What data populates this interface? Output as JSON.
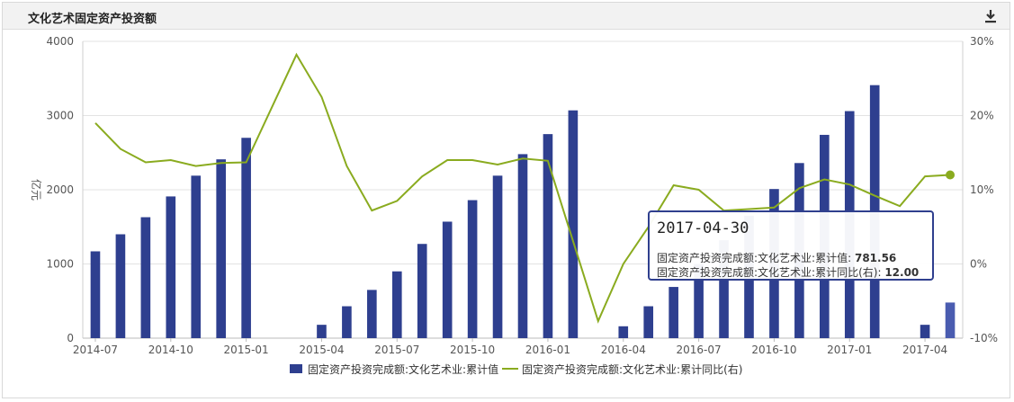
{
  "panel": {
    "title": "文化艺术固定资产投资额",
    "download_icon": "download-icon"
  },
  "tooltip": {
    "date": "2017-04-30",
    "row1_label": "固定资产投资完成额:文化艺术业:累计值:",
    "row1_value": "781.56",
    "row2_label": "固定资产投资完成额:文化艺术业:累计同比(右):",
    "row2_value": "12.00"
  },
  "chart_data": {
    "type": "bar",
    "ylabel": "亿元",
    "y_left_ticks": [
      "4000",
      "3000",
      "2000",
      "1000",
      "0"
    ],
    "y_right_ticks": [
      "30%",
      "20%",
      "10%",
      "0%",
      "-10%"
    ],
    "ylim": [
      0,
      4000
    ],
    "y2lim": [
      -10,
      30
    ],
    "x_tick_labels": [
      "2014-07",
      "2014-10",
      "2015-01",
      "2015-04",
      "2015-07",
      "2015-10",
      "2016-01",
      "2016-04",
      "2016-07",
      "2016-10",
      "2017-01",
      "2017-04"
    ],
    "x_ticks_months": [
      "2014-07",
      "2014-10",
      "2015-01",
      "2015-04",
      "2015-07",
      "2015-10",
      "2016-01",
      "2016-04",
      "2016-07",
      "2016-10",
      "2017-01",
      "2017-04"
    ],
    "months": [
      "2014-07",
      "2014-08",
      "2014-09",
      "2014-10",
      "2014-11",
      "2014-12",
      "2015-01",
      "2015-02",
      "2015-03",
      "2015-04",
      "2015-05",
      "2015-06",
      "2015-07",
      "2015-08",
      "2015-09",
      "2015-10",
      "2015-11",
      "2015-12",
      "2016-01",
      "2016-02",
      "2016-03",
      "2016-04",
      "2016-05",
      "2016-06",
      "2016-07",
      "2016-08",
      "2016-09",
      "2016-10",
      "2016-11",
      "2016-12",
      "2017-01",
      "2017-02",
      "2017-03",
      "2017-04"
    ],
    "series": [
      {
        "name": "固定资产投资完成额:文化艺术业:累计值",
        "axis": "left",
        "kind": "bar",
        "color": "#2e3f8f",
        "highlight_color": "#4a5cb0",
        "values": [
          1170,
          1400,
          1630,
          1910,
          2190,
          2410,
          2700,
          null,
          null,
          180,
          430,
          650,
          900,
          1270,
          1570,
          1860,
          2190,
          2480,
          2750,
          3070,
          null,
          160,
          430,
          690,
          1000,
          1320,
          1650,
          2010,
          2360,
          2740,
          3060,
          3410,
          null,
          180,
          480,
          781.56
        ]
      },
      {
        "name": "固定资产投资完成额:文化艺术业:累计同比(右)",
        "axis": "right",
        "kind": "line",
        "color": "#8aab1f",
        "values": [
          19,
          15.5,
          13.7,
          14,
          13.2,
          13.6,
          13.7,
          null,
          28.2,
          22.5,
          13.2,
          7.2,
          8.5,
          11.8,
          14,
          14,
          13.4,
          14.2,
          13.9,
          null,
          -7.7,
          0,
          5,
          10.6,
          10,
          7.2,
          7.4,
          7.6,
          10.2,
          11.4,
          10.7,
          9.2,
          7.8,
          11.8,
          12
        ]
      }
    ],
    "legend_position": "bottom",
    "grid": true
  }
}
